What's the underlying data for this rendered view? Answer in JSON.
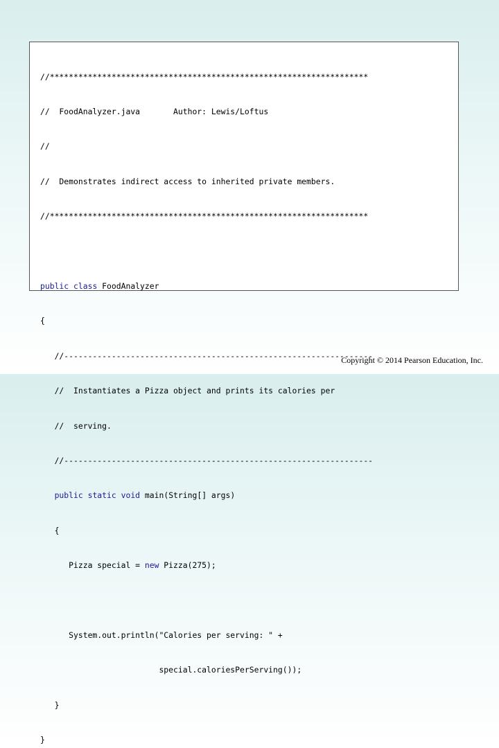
{
  "code": {
    "header_border": "//*******************************************************************",
    "header_title": "//  FoodAnalyzer.java       Author: Lewis/Loftus",
    "header_empty": "//",
    "header_desc": "//  Demonstrates indirect access to inherited private members.",
    "class_public": "public",
    "class_class": "class",
    "class_name": " FoodAnalyzer",
    "open_brace": "{",
    "method_border": "   //-----------------------------------------------------------------",
    "method_comment_1": "   //  Instantiates a Pizza object and prints its calories per",
    "method_comment_2": "   //  serving.",
    "method_public": "public",
    "method_static": "static",
    "method_void": "void",
    "method_sig": " main(String[] args)",
    "method_open": "   {",
    "stmt1_prefix": "      Pizza special = ",
    "stmt1_new": "new",
    "stmt1_suffix": " Pizza(275);",
    "stmt2_line1": "      System.out.println(\"Calories per serving: \" +",
    "stmt2_line2": "                         special.caloriesPerServing());",
    "method_close": "   }",
    "close_brace": "}"
  },
  "footer": {
    "copyright": "Copyright © 2014 Pearson Education, Inc."
  },
  "colors": {
    "keyword": "#1a1a99",
    "text": "#000000",
    "background_top": "#d9eeee"
  }
}
